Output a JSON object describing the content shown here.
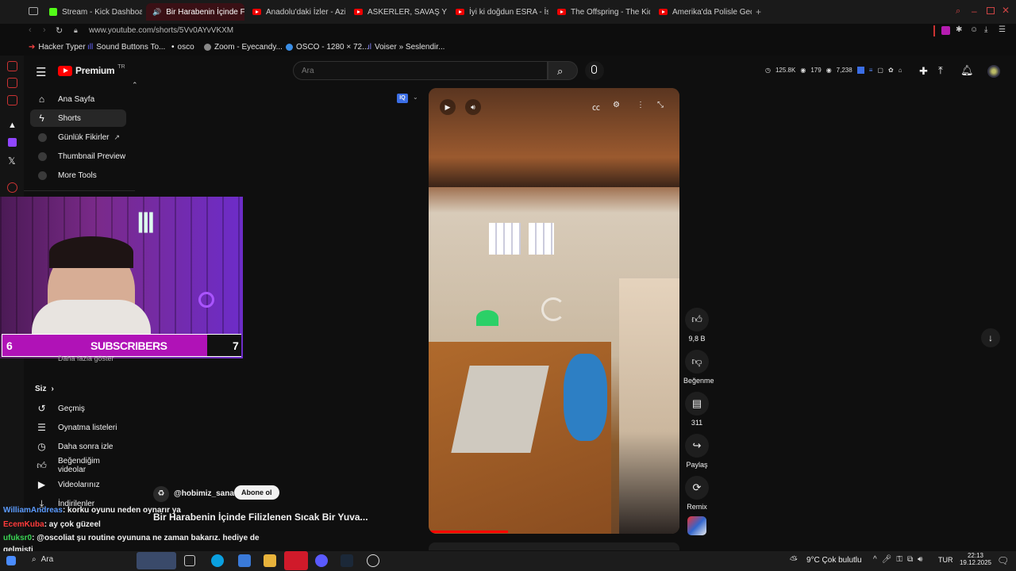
{
  "tabs": [
    {
      "label": "Stream - Kick Dashboard",
      "icon": "kick-icon"
    },
    {
      "label": "Bir Harabenin İçinde F",
      "icon": "youtube-icon",
      "active": true
    },
    {
      "label": "Anadolu'daki İzler - Aziz",
      "icon": "youtube-icon"
    },
    {
      "label": "ASKERLER, SAVAŞ YEME",
      "icon": "youtube-icon"
    },
    {
      "label": "İyi ki doğdun ESRA - İsmo",
      "icon": "youtube-icon"
    },
    {
      "label": "The Offspring - The Kids",
      "icon": "youtube-icon"
    },
    {
      "label": "Amerika'da Polisle Gece D",
      "icon": "youtube-icon"
    }
  ],
  "url": "www.youtube.com/shorts/5Vv0AYvVKXM",
  "bookmarks": [
    "Hacker Typer",
    "Sound Buttons To...",
    "osco",
    "Zoom - Eyecandy...",
    "OSCO - 1280 × 72...",
    "Voiser » Seslendir..."
  ],
  "header": {
    "logo": "Premium",
    "logo_sup": "TR",
    "search_placeholder": "Ara",
    "stats": [
      "125.8K",
      "179",
      "7,238"
    ]
  },
  "sidebar": {
    "items": [
      {
        "label": "Ana Sayfa",
        "icon": "home-icon"
      },
      {
        "label": "Shorts",
        "icon": "shorts-icon",
        "selected": true
      },
      {
        "label": "Günlük Fikirler",
        "icon": "channel-icon"
      },
      {
        "label": "Thumbnail Preview",
        "icon": "channel-icon"
      },
      {
        "label": "More Tools",
        "icon": "channel-icon"
      }
    ],
    "more_label": "Daha fazla göster",
    "you_label": "Siz",
    "you_items": [
      {
        "label": "Geçmiş",
        "icon": "history-icon"
      },
      {
        "label": "Oynatma listeleri",
        "icon": "playlist-icon"
      },
      {
        "label": "Daha sonra izle",
        "icon": "clock-icon"
      },
      {
        "label": "Beğendiğim videolar",
        "icon": "like-icon"
      },
      {
        "label": "Videolarınız",
        "icon": "video-icon"
      },
      {
        "label": "İndirilenler",
        "icon": "download-icon"
      }
    ]
  },
  "webcam": {
    "left_count": "6",
    "label": "SUBSCRIBERS",
    "right_count": "7"
  },
  "short": {
    "channel": "@hobimiz_sanat",
    "subscribe": "Abone ol",
    "title": "Bir Harabenin İçinde Filizlenen Sıcak Bir Yuva...",
    "likes": "9,8 B",
    "dislike": "Beğenme",
    "comments": "311",
    "share": "Paylaş",
    "remix": "Remix"
  },
  "chat": [
    {
      "user": "WilliamAndreas",
      "msg": ": korku oyunu neden oynarır ya",
      "color": "#5b9bff"
    },
    {
      "user": "EcemKuba",
      "msg": ": ay çok güzeel",
      "color": "#ff3b3b"
    },
    {
      "user": "ufuksr0",
      "msg": ": @oscoliat şu routine oyununa ne zaman bakarız. hediye de",
      "color": "#39d353"
    },
    {
      "user": "",
      "msg": "gelmişti",
      "color": "#ffffff"
    }
  ],
  "taskbar": {
    "search": "Ara",
    "weather": "9°C  Çok bulutlu",
    "lang": "TUR",
    "time": "22:13",
    "date": "19.12.2025"
  }
}
